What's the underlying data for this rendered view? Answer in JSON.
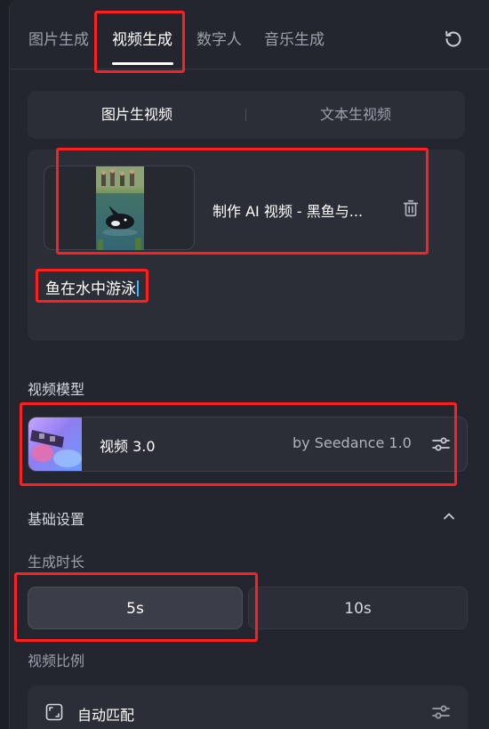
{
  "tabs": [
    {
      "label": "图片生成",
      "active": false
    },
    {
      "label": "视频生成",
      "active": true
    },
    {
      "label": "数字人",
      "active": false
    },
    {
      "label": "音乐生成",
      "active": false
    }
  ],
  "mode_switch": {
    "options": [
      "图片生视频",
      "文本生视频"
    ],
    "selected": "图片生视频"
  },
  "prompt": {
    "attachment_name": "制作 AI 视频 - 黑鱼与...",
    "text": "鱼在水中游泳"
  },
  "model_section": {
    "title": "视频模型",
    "model_name": "视频 3.0",
    "model_by": "by Seedance 1.0"
  },
  "basic_settings": {
    "title": "基础设置",
    "duration_label": "生成时长",
    "durations": [
      "5s",
      "10s"
    ],
    "selected_duration": "5s",
    "ratio_label": "视频比例",
    "ratio_value": "自动匹配"
  },
  "colors": {
    "background": "#23262e",
    "card": "#2b2e36",
    "annotation": "#ff1f1f",
    "caret": "#3db8ff"
  },
  "icons": [
    "refresh-icon",
    "trash-icon",
    "settings-sliders-icon",
    "chevron-up-icon",
    "aspect-ratio-icon"
  ]
}
